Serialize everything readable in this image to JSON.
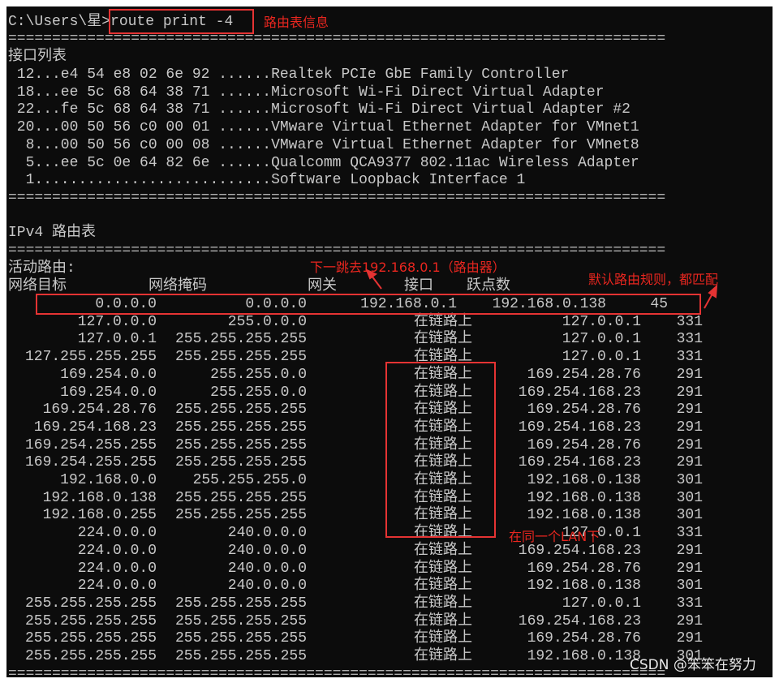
{
  "prompt": "C:\\Users\\星>",
  "command": "route print -4",
  "separator": "===========================================================================",
  "interface_list": {
    "title": "接口列表",
    "items": [
      {
        "id": "12",
        "mac": "e4 54 e8 02 6e 92",
        "name": "Realtek PCIe GbE Family Controller"
      },
      {
        "id": "18",
        "mac": "ee 5c 68 64 38 71",
        "name": "Microsoft Wi-Fi Direct Virtual Adapter"
      },
      {
        "id": "22",
        "mac": "fe 5c 68 64 38 71",
        "name": "Microsoft Wi-Fi Direct Virtual Adapter #2"
      },
      {
        "id": "20",
        "mac": "00 50 56 c0 00 01",
        "name": "VMware Virtual Ethernet Adapter for VMnet1"
      },
      {
        "id": "8",
        "mac": "00 50 56 c0 00 08",
        "name": "VMware Virtual Ethernet Adapter for VMnet8"
      },
      {
        "id": "5",
        "mac": "ee 5c 0e 64 82 6e",
        "name": "Qualcomm QCA9377 802.11ac Wireless Adapter"
      },
      {
        "id": "1",
        "mac": "",
        "name": "Software Loopback Interface 1"
      }
    ]
  },
  "ipv4": {
    "title": "IPv4 路由表",
    "active_label": "活动路由:",
    "headers": {
      "dest": "网络目标",
      "mask": "网络掩码",
      "gateway": "网关",
      "iface": "接口",
      "metric": "跃点数"
    },
    "routes": [
      {
        "dest": "0.0.0.0",
        "mask": "0.0.0.0",
        "gateway": "192.168.0.1",
        "iface": "192.168.0.138",
        "metric": "45"
      },
      {
        "dest": "127.0.0.0",
        "mask": "255.0.0.0",
        "gateway": "在链路上",
        "iface": "127.0.0.1",
        "metric": "331"
      },
      {
        "dest": "127.0.0.1",
        "mask": "255.255.255.255",
        "gateway": "在链路上",
        "iface": "127.0.0.1",
        "metric": "331"
      },
      {
        "dest": "127.255.255.255",
        "mask": "255.255.255.255",
        "gateway": "在链路上",
        "iface": "127.0.0.1",
        "metric": "331"
      },
      {
        "dest": "169.254.0.0",
        "mask": "255.255.0.0",
        "gateway": "在链路上",
        "iface": "169.254.28.76",
        "metric": "291"
      },
      {
        "dest": "169.254.0.0",
        "mask": "255.255.0.0",
        "gateway": "在链路上",
        "iface": "169.254.168.23",
        "metric": "291"
      },
      {
        "dest": "169.254.28.76",
        "mask": "255.255.255.255",
        "gateway": "在链路上",
        "iface": "169.254.28.76",
        "metric": "291"
      },
      {
        "dest": "169.254.168.23",
        "mask": "255.255.255.255",
        "gateway": "在链路上",
        "iface": "169.254.168.23",
        "metric": "291"
      },
      {
        "dest": "169.254.255.255",
        "mask": "255.255.255.255",
        "gateway": "在链路上",
        "iface": "169.254.28.76",
        "metric": "291"
      },
      {
        "dest": "169.254.255.255",
        "mask": "255.255.255.255",
        "gateway": "在链路上",
        "iface": "169.254.168.23",
        "metric": "291"
      },
      {
        "dest": "192.168.0.0",
        "mask": "255.255.255.0",
        "gateway": "在链路上",
        "iface": "192.168.0.138",
        "metric": "301"
      },
      {
        "dest": "192.168.0.138",
        "mask": "255.255.255.255",
        "gateway": "在链路上",
        "iface": "192.168.0.138",
        "metric": "301"
      },
      {
        "dest": "192.168.0.255",
        "mask": "255.255.255.255",
        "gateway": "在链路上",
        "iface": "192.168.0.138",
        "metric": "301"
      },
      {
        "dest": "224.0.0.0",
        "mask": "240.0.0.0",
        "gateway": "在链路上",
        "iface": "127.0.0.1",
        "metric": "331"
      },
      {
        "dest": "224.0.0.0",
        "mask": "240.0.0.0",
        "gateway": "在链路上",
        "iface": "169.254.168.23",
        "metric": "291"
      },
      {
        "dest": "224.0.0.0",
        "mask": "240.0.0.0",
        "gateway": "在链路上",
        "iface": "169.254.28.76",
        "metric": "291"
      },
      {
        "dest": "224.0.0.0",
        "mask": "240.0.0.0",
        "gateway": "在链路上",
        "iface": "192.168.0.138",
        "metric": "301"
      },
      {
        "dest": "255.255.255.255",
        "mask": "255.255.255.255",
        "gateway": "在链路上",
        "iface": "127.0.0.1",
        "metric": "331"
      },
      {
        "dest": "255.255.255.255",
        "mask": "255.255.255.255",
        "gateway": "在链路上",
        "iface": "169.254.168.23",
        "metric": "291"
      },
      {
        "dest": "255.255.255.255",
        "mask": "255.255.255.255",
        "gateway": "在链路上",
        "iface": "169.254.28.76",
        "metric": "291"
      },
      {
        "dest": "255.255.255.255",
        "mask": "255.255.255.255",
        "gateway": "在链路上",
        "iface": "192.168.0.138",
        "metric": "301"
      }
    ]
  },
  "annotations": {
    "routing_table_info": "路由表信息",
    "next_hop": "下一跳去192.168.0.1（路由器）",
    "default_route": "默认路由规则，都匹配",
    "same_lan": "在同一个LAN下",
    "accent_color": "#e53333"
  },
  "watermark": "CSDN @笨笨在努力"
}
